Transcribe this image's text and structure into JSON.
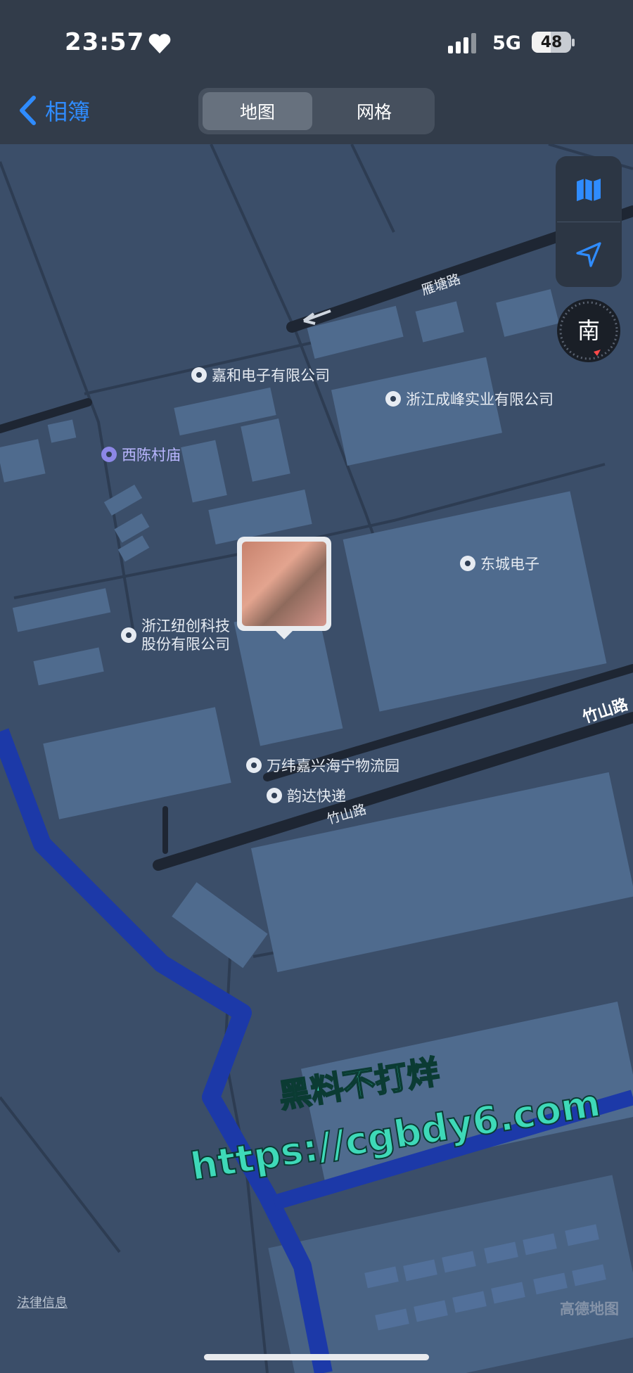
{
  "status_bar": {
    "time": "23:57",
    "network": "5G",
    "battery": "48"
  },
  "nav": {
    "back_label": "相簿",
    "segments": [
      "地图",
      "网格"
    ],
    "selected_segment": "地图"
  },
  "map": {
    "roads": [
      "雁塘路",
      "竹山路",
      "竹山路"
    ],
    "pois": [
      {
        "name": "嘉和电子有限公司"
      },
      {
        "name": "浙江成峰实业有限公司"
      },
      {
        "name": "西陈村庙"
      },
      {
        "name": "东城电子"
      },
      {
        "name": "浙江纽创科技",
        "name_line2": "股份有限公司"
      },
      {
        "name": "万纬嘉兴海宁物流园"
      },
      {
        "name": "韵达快递"
      }
    ],
    "legal_link": "法律信息",
    "provider": "高德地图",
    "compass_label": "南"
  },
  "watermark": {
    "line1": "黑料不打烊",
    "line2": "https://cgbdy6.com"
  },
  "colors": {
    "accent": "#2f8cff",
    "map_bg": "#3b4e69",
    "block": "#4f6b8e",
    "road": "#1e2633",
    "river": "#1c39a8",
    "watermark": "#3ed9b8"
  },
  "icons": [
    "heart-icon",
    "signal-icon",
    "battery-icon",
    "back-chevron-icon",
    "map-mode-icon",
    "location-arrow-icon",
    "compass-icon"
  ]
}
